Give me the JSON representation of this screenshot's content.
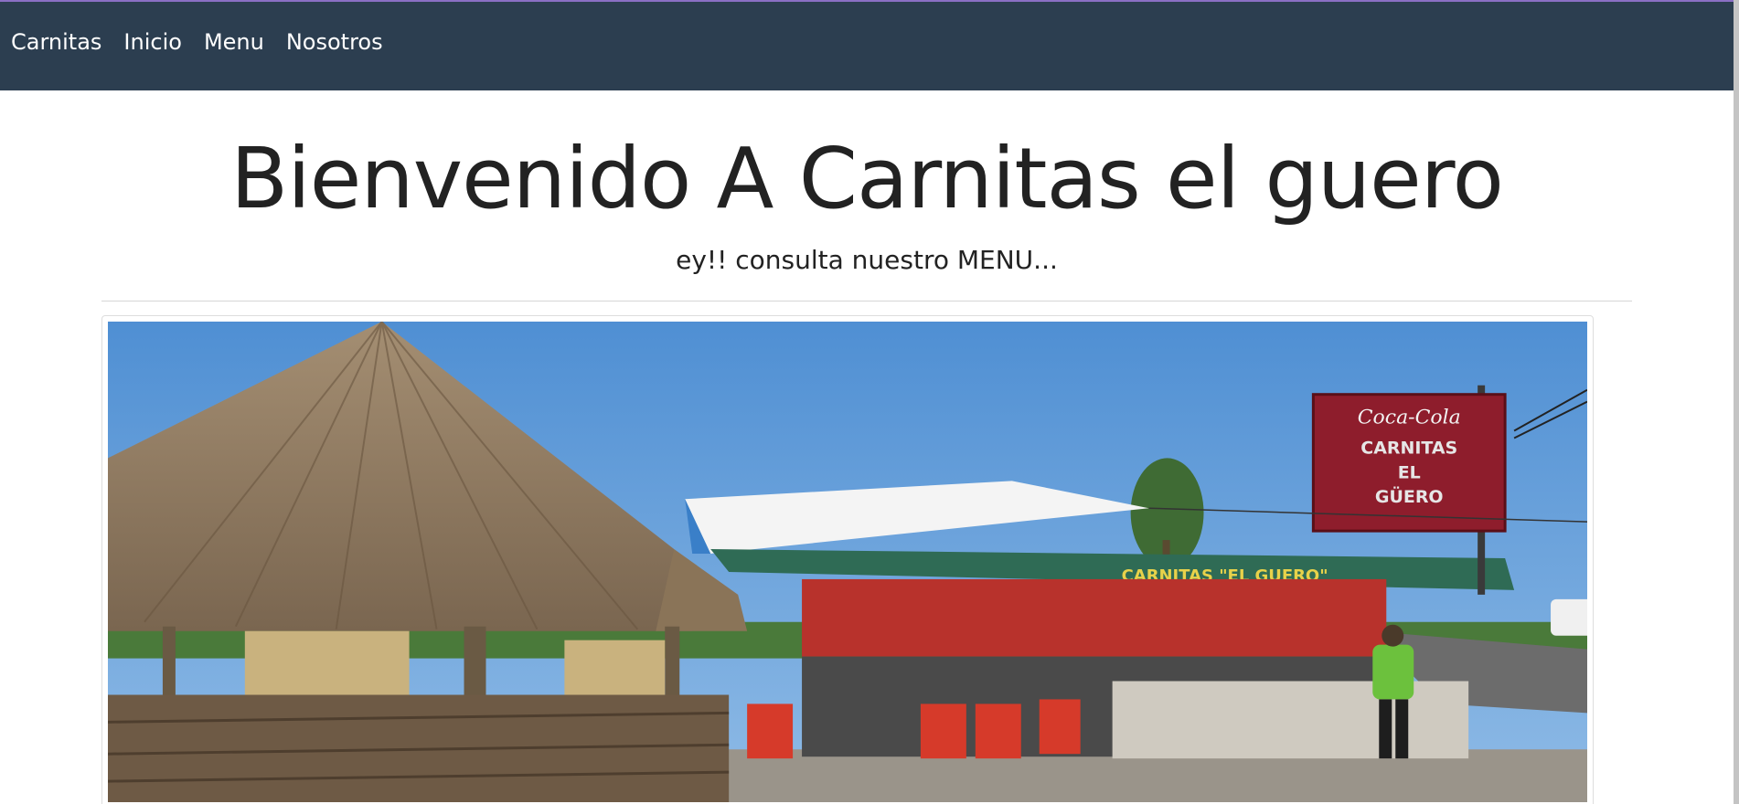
{
  "nav": {
    "brand": "Carnitas",
    "items": [
      {
        "label": "Inicio"
      },
      {
        "label": "Menu"
      },
      {
        "label": "Nosotros"
      }
    ]
  },
  "hero": {
    "title": "Bienvenido A Carnitas el guero",
    "subtitle": "ey!! consulta nuestro MENU..."
  },
  "photo": {
    "sign_brand": "Coca-Cola",
    "sign_line1": "CARNITAS",
    "sign_line2": "EL",
    "sign_line3": "GÜERO",
    "awning_text": "CARNITAS   \"EL GUERO\""
  },
  "colors": {
    "navbar": "#2c3e50",
    "accent_line": "#8a6fc4",
    "sky": "#5b9bd8",
    "sign": "#8e1d2c"
  }
}
